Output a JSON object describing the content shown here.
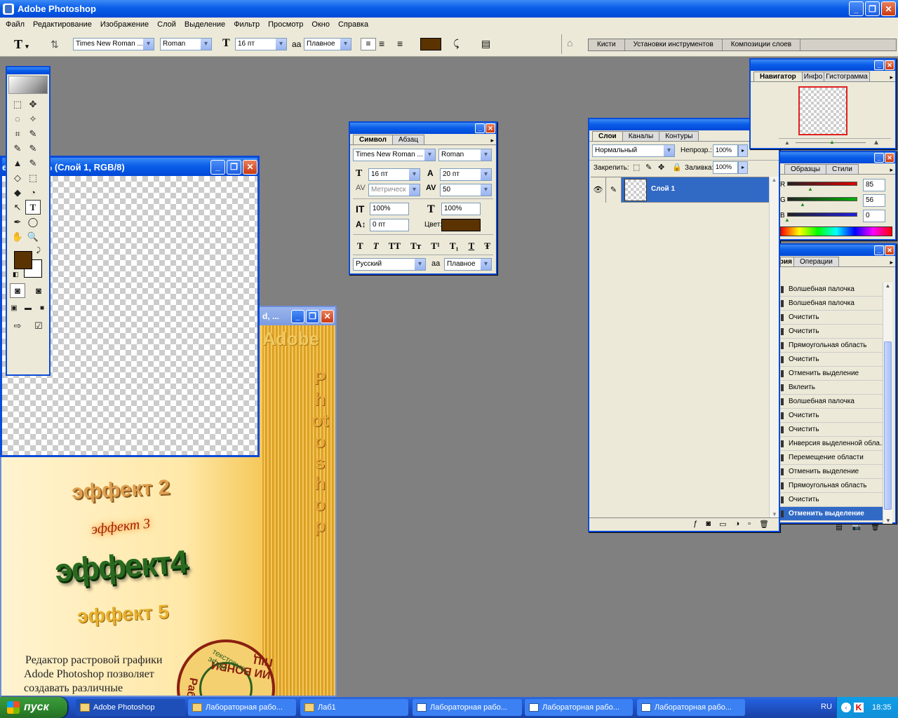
{
  "app": {
    "title": "Adobe Photoshop"
  },
  "menu": [
    "Файл",
    "Редактирование",
    "Изображение",
    "Слой",
    "Выделение",
    "Фильтр",
    "Просмотр",
    "Окно",
    "Справка"
  ],
  "options": {
    "tool_glyph": "T",
    "font_family": "Times New Roman ...",
    "font_style": "Roman",
    "font_size": "16 пт",
    "aa_glyph": "aa",
    "antialias": "Плавное",
    "color": "#5a3300"
  },
  "wells": [
    "Кисти",
    "Установки инструментов",
    "Композиции слоев"
  ],
  "doc1": {
    "title": "е... @ 100% (Слой 1, RGB/8)"
  },
  "doc2": {
    "title": "d, ...",
    "art": {
      "adobe": "Adobe",
      "vertical": "Photoshop",
      "e2": "эффект 2",
      "e3": "эффект 3",
      "e4": "эффект4",
      "e5": "эффект 5",
      "para": [
        "Редактор растровой графики",
        "Adode Photoshop позволяет",
        "создавать различные"
      ],
      "stamp_outer": "ИИ ВОНВИ ПІЦ",
      "stamp_left": "Раб",
      "stamp_inner": "текстовые эффе"
    }
  },
  "symbol_panel": {
    "tabs": [
      "Символ",
      "Абзац"
    ],
    "font_family": "Times New Roman ...",
    "font_style": "Roman",
    "size": "16 пт",
    "leading": "20 пт",
    "kerning": "Метрическ",
    "tracking": "50",
    "vscale": "100%",
    "hscale": "100%",
    "baseline": "0 пт",
    "color_label": "Цвет:",
    "color": "#5a3300",
    "styles": [
      "T",
      "T",
      "TT",
      "Tт",
      "T¹",
      "T₁",
      "T",
      "Ŧ"
    ],
    "language": "Русский",
    "antialias": "Плавное"
  },
  "layers_panel": {
    "tabs": [
      "Слои",
      "Каналы",
      "Контуры"
    ],
    "blend": "Нормальный",
    "opacity_label": "Непрозр.:",
    "opacity": "100%",
    "lock_label": "Закрепить:",
    "fill_label": "Заливка:",
    "fill": "100%",
    "layer": "Слой 1"
  },
  "navigator": {
    "tabs": [
      "Навигатор",
      "Инфо",
      "Гистограмма"
    ]
  },
  "color_panel": {
    "tabs": [
      "Образцы",
      "Стили"
    ],
    "channels": [
      {
        "label": "R",
        "value": "85",
        "color": "#e00000"
      },
      {
        "label": "G",
        "value": "56",
        "color": "#00b000"
      },
      {
        "label": "B",
        "value": "0",
        "color": "#2020e0"
      }
    ]
  },
  "history_panel": {
    "tabs": [
      "История",
      "Операции"
    ],
    "items": [
      "Волшебная палочка",
      "Волшебная палочка",
      "Очистить",
      "Очистить",
      "Прямоугольная область",
      "Очистить",
      "Отменить выделение",
      "Вклеить",
      "Волшебная палочка",
      "Очистить",
      "Очистить",
      "Инверсия выделенной обла...",
      "Перемещение области",
      "Отменить выделение",
      "Прямоугольная область",
      "Очистить",
      "Отменить выделение"
    ]
  },
  "toolbox": {
    "fg": "#5a3300",
    "bg": "#ffffff",
    "tools": [
      "⬚",
      "✥",
      "◌",
      "✧",
      "⌗",
      "✎",
      "✎",
      "✎",
      "▲",
      "✎",
      "◇",
      "⬚",
      "◆",
      "◔",
      "↖",
      "T",
      "✒",
      "◯",
      "✋",
      "🔍"
    ]
  },
  "taskbar": {
    "start": "пуск",
    "items": [
      "Adobe Photoshop",
      "Лабораторная рабо...",
      "Лаб1",
      "Лабораторная рабо...",
      "Лабораторная рабо...",
      "Лабораторная рабо..."
    ],
    "lang": "RU",
    "time": "18:35"
  }
}
